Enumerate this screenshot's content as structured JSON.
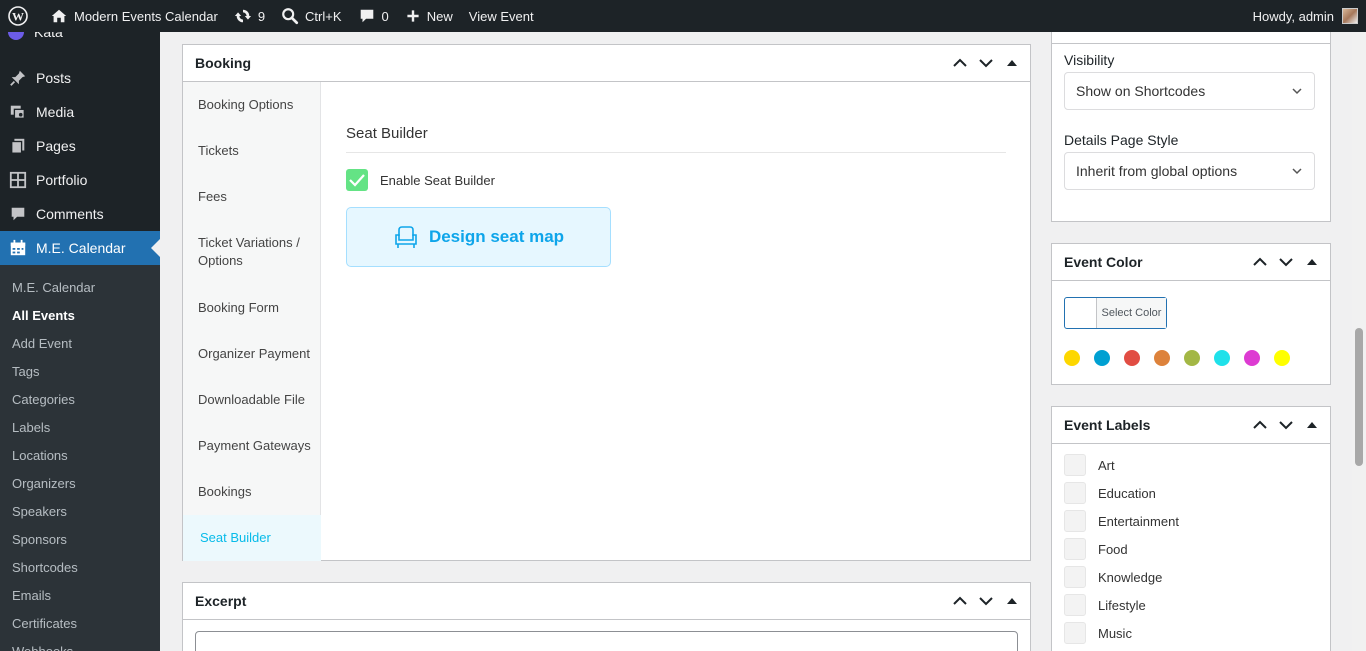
{
  "adminbar": {
    "site_name": "Modern Events Calendar",
    "updates_count": "9",
    "search_shortcut": "Ctrl+K",
    "comments_count": "0",
    "new_label": "New",
    "view_event_label": "View Event",
    "howdy": "Howdy, admin"
  },
  "sidebar": {
    "partial_top": "Kata",
    "top_items": [
      {
        "label": "Posts",
        "icon": "pin-icon"
      },
      {
        "label": "Media",
        "icon": "media-icon"
      },
      {
        "label": "Pages",
        "icon": "pages-icon"
      },
      {
        "label": "Portfolio",
        "icon": "portfolio-icon"
      },
      {
        "label": "Comments",
        "icon": "comments-icon"
      },
      {
        "label": "M.E. Calendar",
        "icon": "calendar-icon"
      }
    ],
    "submenu": [
      "M.E. Calendar",
      "All Events",
      "Add Event",
      "Tags",
      "Categories",
      "Labels",
      "Locations",
      "Organizers",
      "Speakers",
      "Sponsors",
      "Shortcodes",
      "Emails",
      "Certificates",
      "Webhooks"
    ]
  },
  "booking": {
    "title": "Booking",
    "tabs": [
      "Booking Options",
      "Tickets",
      "Fees",
      "Ticket Variations / Options",
      "Booking Form",
      "Organizer Payment",
      "Downloadable File",
      "Payment Gateways",
      "Bookings",
      "Seat Builder"
    ],
    "active_tab": "Seat Builder",
    "section_title": "Seat Builder",
    "enable_label": "Enable Seat Builder",
    "design_button": "Design seat map"
  },
  "excerpt": {
    "title": "Excerpt"
  },
  "visibility": {
    "visibility_label": "Visibility",
    "visibility_value": "Show on Shortcodes",
    "style_label": "Details Page Style",
    "style_value": "Inherit from global options"
  },
  "event_color": {
    "title": "Event Color",
    "select_label": "Select Color",
    "colors": [
      "#fdd700",
      "#00a0d2",
      "#e14d43",
      "#dd823b",
      "#a3b745",
      "#1fe1ea",
      "#dd3bd2",
      "#ffff00"
    ]
  },
  "event_labels": {
    "title": "Event Labels",
    "items": [
      "Art",
      "Education",
      "Entertainment",
      "Food",
      "Knowledge",
      "Lifestyle",
      "Music"
    ]
  }
}
